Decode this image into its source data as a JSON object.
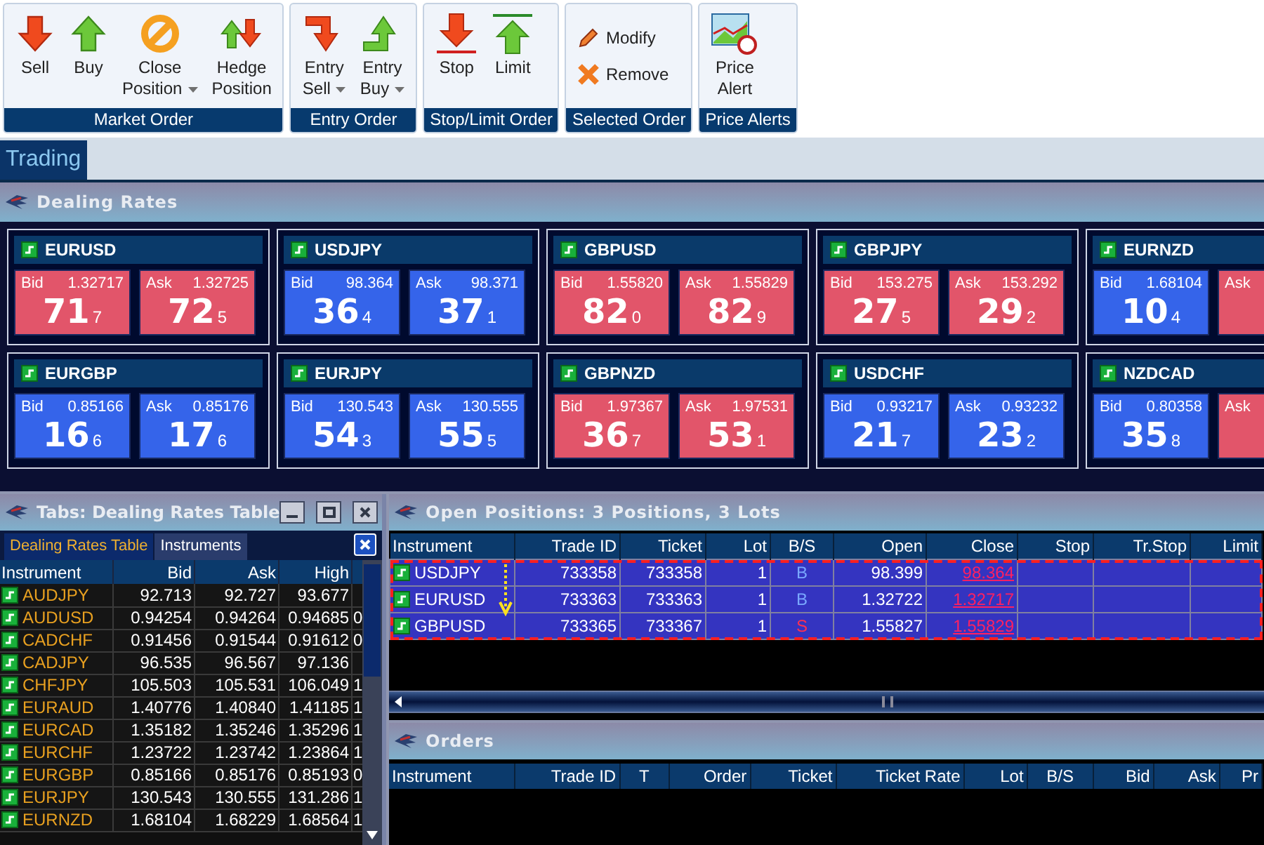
{
  "ribbon": {
    "groups": [
      {
        "label": "Market Order",
        "kind": "large",
        "buttons": [
          {
            "lines": [
              "Sell"
            ],
            "dropdown": false
          },
          {
            "lines": [
              "Buy"
            ],
            "dropdown": false
          },
          {
            "lines": [
              "Close",
              "Position"
            ],
            "dropdown": true
          },
          {
            "lines": [
              "Hedge",
              "Position"
            ],
            "dropdown": false
          }
        ]
      },
      {
        "label": "Entry Order",
        "kind": "large",
        "buttons": [
          {
            "lines": [
              "Entry",
              "Sell"
            ],
            "dropdown": true
          },
          {
            "lines": [
              "Entry",
              "Buy"
            ],
            "dropdown": true
          }
        ]
      },
      {
        "label": "Stop/Limit Order",
        "kind": "large",
        "buttons": [
          {
            "lines": [
              "Stop"
            ],
            "dropdown": false
          },
          {
            "lines": [
              "Limit"
            ],
            "dropdown": false
          }
        ]
      },
      {
        "label": "Selected Order",
        "kind": "small",
        "buttons": [
          {
            "lines": [
              "Modify"
            ]
          },
          {
            "lines": [
              "Remove"
            ]
          }
        ]
      },
      {
        "label": "Price Alerts",
        "kind": "large",
        "buttons": [
          {
            "lines": [
              "Price",
              "Alert"
            ],
            "dropdown": false
          }
        ]
      }
    ]
  },
  "workspace_tabs": [
    {
      "label": "Trading",
      "selected": true
    }
  ],
  "dealing_rates": {
    "title": "Dealing Rates",
    "tiles": [
      {
        "instrument": "EURUSD",
        "bid": {
          "label": "Bid",
          "price": "1.32717",
          "big": "71",
          "pip": "7",
          "color": "#e2556a"
        },
        "ask": {
          "label": "Ask",
          "price": "1.32725",
          "big": "72",
          "pip": "5",
          "color": "#e2556a"
        }
      },
      {
        "instrument": "USDJPY",
        "bid": {
          "label": "Bid",
          "price": "98.364",
          "big": "36",
          "pip": "4",
          "color": "#3564ea"
        },
        "ask": {
          "label": "Ask",
          "price": "98.371",
          "big": "37",
          "pip": "1",
          "color": "#3564ea"
        }
      },
      {
        "instrument": "GBPUSD",
        "bid": {
          "label": "Bid",
          "price": "1.55820",
          "big": "82",
          "pip": "0",
          "color": "#e2556a"
        },
        "ask": {
          "label": "Ask",
          "price": "1.55829",
          "big": "82",
          "pip": "9",
          "color": "#e2556a"
        }
      },
      {
        "instrument": "GBPJPY",
        "bid": {
          "label": "Bid",
          "price": "153.275",
          "big": "27",
          "pip": "5",
          "color": "#e2556a"
        },
        "ask": {
          "label": "Ask",
          "price": "153.292",
          "big": "29",
          "pip": "2",
          "color": "#e2556a"
        }
      },
      {
        "instrument": "EURNZD",
        "bid": {
          "label": "Bid",
          "price": "1.68104",
          "big": "10",
          "pip": "4",
          "color": "#3564ea"
        },
        "ask": {
          "label": "Ask",
          "color": "#e2556a"
        }
      },
      {
        "instrument": "EURGBP",
        "bid": {
          "label": "Bid",
          "price": "0.85166",
          "big": "16",
          "pip": "6",
          "color": "#3564ea"
        },
        "ask": {
          "label": "Ask",
          "price": "0.85176",
          "big": "17",
          "pip": "6",
          "color": "#3564ea"
        }
      },
      {
        "instrument": "EURJPY",
        "bid": {
          "label": "Bid",
          "price": "130.543",
          "big": "54",
          "pip": "3",
          "color": "#3564ea"
        },
        "ask": {
          "label": "Ask",
          "price": "130.555",
          "big": "55",
          "pip": "5",
          "color": "#3564ea"
        }
      },
      {
        "instrument": "GBPNZD",
        "bid": {
          "label": "Bid",
          "price": "1.97367",
          "big": "36",
          "pip": "7",
          "color": "#e2556a"
        },
        "ask": {
          "label": "Ask",
          "price": "1.97531",
          "big": "53",
          "pip": "1",
          "color": "#e2556a"
        }
      },
      {
        "instrument": "USDCHF",
        "bid": {
          "label": "Bid",
          "price": "0.93217",
          "big": "21",
          "pip": "7",
          "color": "#3564ea"
        },
        "ask": {
          "label": "Ask",
          "price": "0.93232",
          "big": "23",
          "pip": "2",
          "color": "#3564ea"
        }
      },
      {
        "instrument": "NZDCAD",
        "bid": {
          "label": "Bid",
          "price": "0.80358",
          "big": "35",
          "pip": "8",
          "color": "#3564ea"
        },
        "ask": {
          "label": "Ask",
          "color": "#e2556a"
        }
      }
    ]
  },
  "rates_table_panel": {
    "title": "Tabs: Dealing Rates Table",
    "tabs": [
      {
        "label": "Dealing Rates Table",
        "selected": true
      },
      {
        "label": "Instruments",
        "selected": false
      }
    ],
    "columns": [
      "Instrument",
      "Bid",
      "Ask",
      "High"
    ],
    "rows": [
      {
        "instrument": "AUDJPY",
        "bid": "92.713",
        "ask": "92.727",
        "high": "93.677"
      },
      {
        "instrument": "AUDUSD",
        "bid": "0.94254",
        "ask": "0.94264",
        "high": "0.94685",
        "column_5": "0"
      },
      {
        "instrument": "CADCHF",
        "bid": "0.91456",
        "ask": "0.91544",
        "high": "0.91612",
        "column_5": "0"
      },
      {
        "instrument": "CADJPY",
        "bid": "96.535",
        "ask": "96.567",
        "high": "97.136"
      },
      {
        "instrument": "CHFJPY",
        "bid": "105.503",
        "ask": "105.531",
        "high": "106.049",
        "column_5": "1"
      },
      {
        "instrument": "EURAUD",
        "bid": "1.40776",
        "ask": "1.40840",
        "high": "1.41185",
        "column_5": "1"
      },
      {
        "instrument": "EURCAD",
        "bid": "1.35182",
        "ask": "1.35246",
        "high": "1.35296",
        "column_5": "1"
      },
      {
        "instrument": "EURCHF",
        "bid": "1.23722",
        "ask": "1.23742",
        "high": "1.23864",
        "column_5": "1"
      },
      {
        "instrument": "EURGBP",
        "bid": "0.85166",
        "ask": "0.85176",
        "high": "0.85193",
        "column_5": "0"
      },
      {
        "instrument": "EURJPY",
        "bid": "130.543",
        "ask": "130.555",
        "high": "131.286",
        "column_5": "1"
      },
      {
        "instrument": "EURNZD",
        "bid": "1.68104",
        "ask": "1.68229",
        "high": "1.68564",
        "column_5": "1"
      }
    ]
  },
  "open_positions": {
    "title": "Open Positions: 3 Positions, 3 Lots",
    "columns": [
      "Instrument",
      "Trade ID",
      "Ticket",
      "Lot",
      "B/S",
      "Open",
      "Close",
      "Stop",
      "Tr.Stop",
      "Limit"
    ],
    "rows": [
      {
        "instrument": "USDJPY",
        "trade_id": "733358",
        "ticket": "733358",
        "lot": "1",
        "side": "B",
        "color": "#7aa8ff",
        "open": "98.399",
        "close": "98.364",
        "selected": true
      },
      {
        "instrument": "EURUSD",
        "trade_id": "733363",
        "ticket": "733363",
        "lot": "1",
        "side": "B",
        "color": "#7aa8ff",
        "open": "1.32722",
        "close": "1.32717",
        "selected": true
      },
      {
        "instrument": "GBPUSD",
        "trade_id": "733365",
        "ticket": "733367",
        "lot": "1",
        "side": "S",
        "color": "#ff3050",
        "open": "1.55827",
        "close": "1.55829",
        "selected": true
      }
    ]
  },
  "orders": {
    "title": "Orders",
    "columns": [
      "Instrument",
      "Trade ID",
      "T",
      "Order",
      "Ticket",
      "Ticket Rate",
      "Lot",
      "B/S",
      "Bid",
      "Ask",
      "Pr"
    ]
  }
}
